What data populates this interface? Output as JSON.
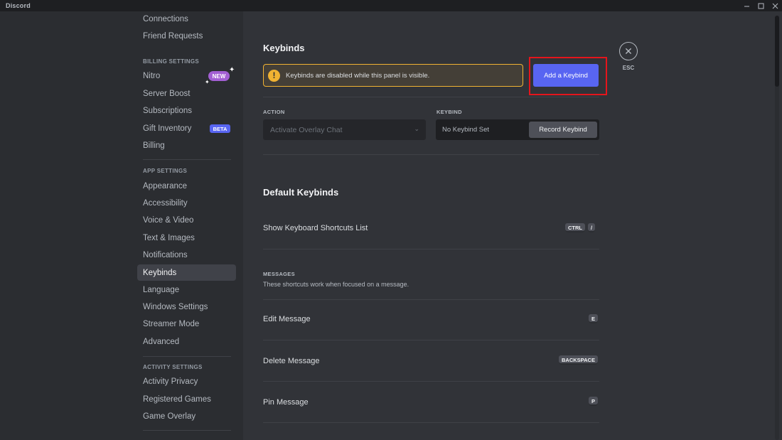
{
  "window": {
    "title": "Discord"
  },
  "sidebar": {
    "items_top": [
      {
        "label": "Connections"
      },
      {
        "label": "Friend Requests"
      }
    ],
    "billing_header": "BILLING SETTINGS",
    "billing_items": [
      {
        "label": "Nitro",
        "badge": "NEW"
      },
      {
        "label": "Server Boost"
      },
      {
        "label": "Subscriptions"
      },
      {
        "label": "Gift Inventory",
        "badge": "BETA"
      },
      {
        "label": "Billing"
      }
    ],
    "app_header": "APP SETTINGS",
    "app_items": [
      {
        "label": "Appearance"
      },
      {
        "label": "Accessibility"
      },
      {
        "label": "Voice & Video"
      },
      {
        "label": "Text & Images"
      },
      {
        "label": "Notifications"
      },
      {
        "label": "Keybinds"
      },
      {
        "label": "Language"
      },
      {
        "label": "Windows Settings"
      },
      {
        "label": "Streamer Mode"
      },
      {
        "label": "Advanced"
      }
    ],
    "activity_header": "ACTIVITY SETTINGS",
    "activity_items": [
      {
        "label": "Activity Privacy"
      },
      {
        "label": "Registered Games"
      },
      {
        "label": "Game Overlay"
      }
    ],
    "active_item": "Keybinds"
  },
  "main": {
    "title": "Keybinds",
    "warning": "Keybinds are disabled while this panel is visible.",
    "add_button": "Add a Keybind",
    "esc_label": "ESC",
    "action_label": "ACTION",
    "keybind_label": "KEYBIND",
    "action_value": "Activate Overlay Chat",
    "keybind_value": "No Keybind Set",
    "record_button": "Record Keybind",
    "default_title": "Default Keybinds",
    "rows": [
      {
        "label": "Show Keyboard Shortcuts List",
        "keys": [
          "CTRL",
          "/"
        ]
      }
    ],
    "messages_header": "MESSAGES",
    "messages_desc": "These shortcuts work when focused on a message.",
    "message_rows": [
      {
        "label": "Edit Message",
        "keys": [
          "E"
        ]
      },
      {
        "label": "Delete Message",
        "keys": [
          "BACKSPACE"
        ]
      },
      {
        "label": "Pin Message",
        "keys": [
          "P"
        ]
      }
    ]
  },
  "colors": {
    "accent": "#5865f2",
    "warning": "#f0b232",
    "highlight": "#e5151c",
    "badge_new": "#a35fd3"
  }
}
